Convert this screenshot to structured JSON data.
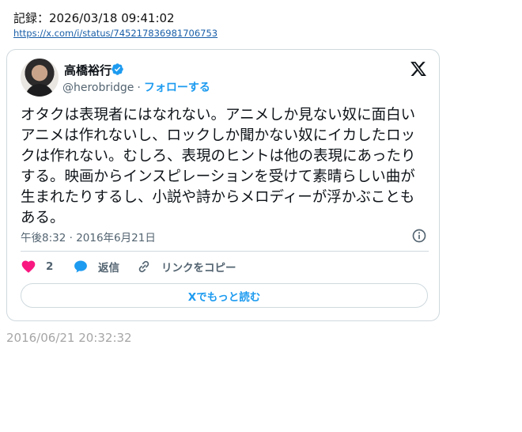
{
  "record": {
    "text": "記録：2026/03/18 09:41:02"
  },
  "source_url": "https://x.com/i/status/745217836981706753",
  "tweet": {
    "author_name": "高橋裕行",
    "handle": "@herobridge",
    "separator": "·",
    "follow_label": "フォローする",
    "text": "オタクは表現者にはなれない。アニメしか見ない奴に面白いアニメは作れないし、ロックしか聞かない奴にイカしたロックは作れない。むしろ、表現のヒントは他の表現にあったりする。映画からインスピレーションを受けて素晴らしい曲が生まれたりするし、小説や詩からメロディーが浮かぶこともある。",
    "timestamp": "午後8:32 · 2016年6月21日",
    "like_count": "2",
    "reply_label": "返信",
    "copy_link_label": "リンクをコピー",
    "read_more_label": "Xでもっと読む"
  },
  "archived_timestamp": "2016/06/21 20:32:32",
  "colors": {
    "accent": "#1d9bf0",
    "like": "#f91880",
    "muted": "#536471",
    "border": "#cfd9de"
  },
  "icons": [
    "x-logo-icon",
    "verified-badge-icon",
    "info-icon",
    "heart-icon",
    "reply-bubble-icon",
    "link-icon"
  ]
}
